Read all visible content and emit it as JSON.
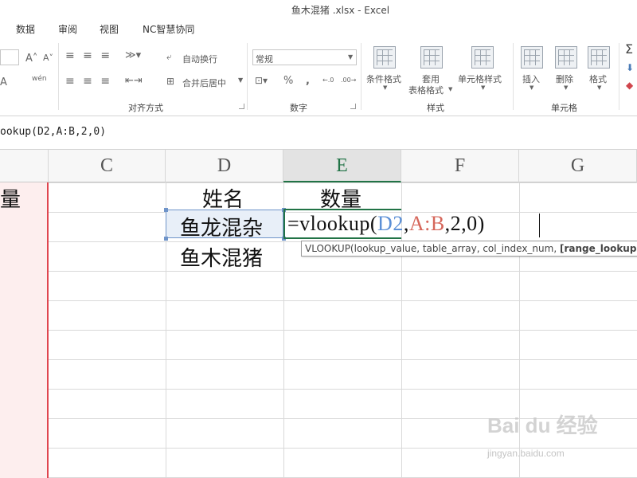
{
  "window": {
    "title": "鱼木混猪 .xlsx - Excel"
  },
  "tabs": [
    "数据",
    "审阅",
    "视图",
    "NC智慧协同"
  ],
  "ribbon": {
    "font": {
      "size_up_icon": "A˄",
      "size_down_icon": "A˅",
      "font_color_icon": "A",
      "phonetic_icon": "wén"
    },
    "alignment": {
      "wrap_text_label": "自动换行",
      "merge_center_label": "合并后居中",
      "group_label": "对齐方式"
    },
    "number": {
      "format_value": "常规",
      "percent_icon": "%",
      "comma_icon": ",",
      "inc_decimal_icon": "←.0",
      "dec_decimal_icon": ".00→",
      "group_label": "数字"
    },
    "styles": {
      "conditional_format_label": "条件格式",
      "table_format_label_1": "套用",
      "table_format_label_2": "表格格式",
      "cell_styles_label": "单元格样式",
      "group_label": "样式"
    },
    "cells": {
      "insert_label": "插入",
      "delete_label": "删除",
      "format_label": "格式",
      "group_label": "单元格"
    }
  },
  "formula_bar": {
    "text": "ookup(D2,A:B,2,0)"
  },
  "columns": [
    "C",
    "D",
    "E",
    "F",
    "G"
  ],
  "active_column": "E",
  "cells": {
    "b1_partial": "量",
    "d1": "姓名",
    "e1": "数量",
    "d2": "鱼龙混杂",
    "d3": "鱼木混猪"
  },
  "editor": {
    "prefix": "=vlookup(",
    "ref1": "D2",
    "comma1": ",",
    "ref2": "A:B",
    "rest": ",2,0)",
    "ref1_color": "#5b8fd6",
    "ref2_color": "#d6675b"
  },
  "tooltip": {
    "text": "VLOOKUP(lookup_value, table_array, col_index_num, ",
    "bold_arg": "[range_lookup]",
    "close": ")"
  },
  "watermark": {
    "text": "Bai du 经验",
    "subtext": "jingyan.baidu.com"
  }
}
